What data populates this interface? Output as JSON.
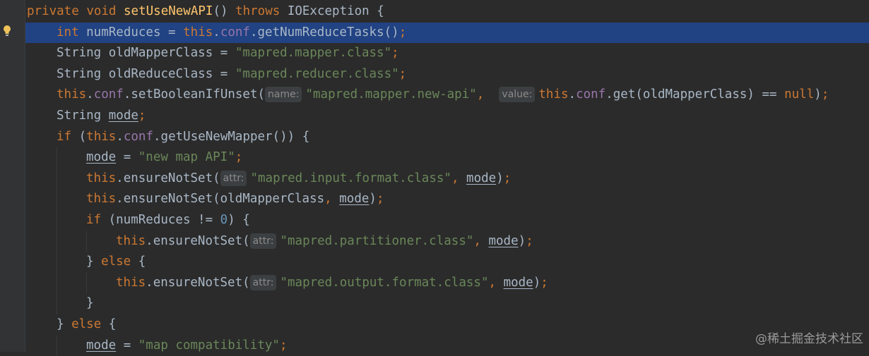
{
  "code": {
    "l1": {
      "t1": "private",
      "t2": " ",
      "t3": "void",
      "t4": " ",
      "t5": "setUseNewAPI",
      "t6": "() ",
      "t7": "throws",
      "t8": " IOException {"
    },
    "l2": {
      "t1": "int",
      "t2": " numReduces = ",
      "t3": "this",
      "t4": ".",
      "t5": "conf",
      "t6": ".getNumReduceTasks()",
      "t7": ";"
    },
    "l3": {
      "t1": "String oldMapperClass = ",
      "t2": "\"mapred.mapper.class\"",
      "t3": ";"
    },
    "l4": {
      "t1": "String oldReduceClass = ",
      "t2": "\"mapred.reducer.class\"",
      "t3": ";"
    },
    "l5": {
      "t1": "this",
      "t2": ".",
      "t3": "conf",
      "t4": ".setBooleanIfUnset(",
      "hint1": "name:",
      "t5": "\"mapred.mapper.new-api\"",
      "t6": ",  ",
      "hint2": "value:",
      "t7": "this",
      "t8": ".",
      "t9": "conf",
      "t10": ".get(oldMapperClass) == ",
      "t11": "null",
      "t12": ")",
      "t13": ";"
    },
    "l6": {
      "t1": "String ",
      "t2": "mode",
      "t3": ";"
    },
    "l7": {
      "t1": "if",
      "t2": " (",
      "t3": "this",
      "t4": ".",
      "t5": "conf",
      "t6": ".getUseNewMapper()) {"
    },
    "l8": {
      "t1": "mode",
      "t2": " = ",
      "t3": "\"new map API\"",
      "t4": ";"
    },
    "l9": {
      "t1": "this",
      "t2": ".ensureNotSet(",
      "hint": "attr:",
      "t3": "\"mapred.input.format.class\"",
      "t4": ", ",
      "t5": "mode",
      "t6": ")",
      "t7": ";"
    },
    "l10": {
      "t1": "this",
      "t2": ".ensureNotSet(oldMapperClass",
      "t3": ", ",
      "t4": "mode",
      "t5": ")",
      "t6": ";"
    },
    "l11": {
      "t1": "if",
      "t2": " (numReduces != ",
      "t3": "0",
      "t4": ") {"
    },
    "l12": {
      "t1": "this",
      "t2": ".ensureNotSet(",
      "hint": "attr:",
      "t3": "\"mapred.partitioner.class\"",
      "t4": ", ",
      "t5": "mode",
      "t6": ")",
      "t7": ";"
    },
    "l13": {
      "t1": "} ",
      "t2": "else",
      "t3": " {"
    },
    "l14": {
      "t1": "this",
      "t2": ".ensureNotSet(",
      "hint": "attr:",
      "t3": "\"mapred.output.format.class\"",
      "t4": ", ",
      "t5": "mode",
      "t6": ")",
      "t7": ";"
    },
    "l15": {
      "t1": "}"
    },
    "l16": {
      "t1": "} ",
      "t2": "else",
      "t3": " {"
    },
    "l17": {
      "t1": "mode",
      "t2": " = ",
      "t3": "\"map compatibility\"",
      "t4": ";"
    }
  },
  "watermark": "@稀土掘金技术社区",
  "icons": {
    "intention": "lightbulb-icon"
  },
  "colors": {
    "background": "#2b2b2b",
    "current_line": "#214283",
    "keyword": "#cc7832",
    "string": "#6a8759",
    "field": "#9876aa",
    "method": "#ffc66d"
  }
}
